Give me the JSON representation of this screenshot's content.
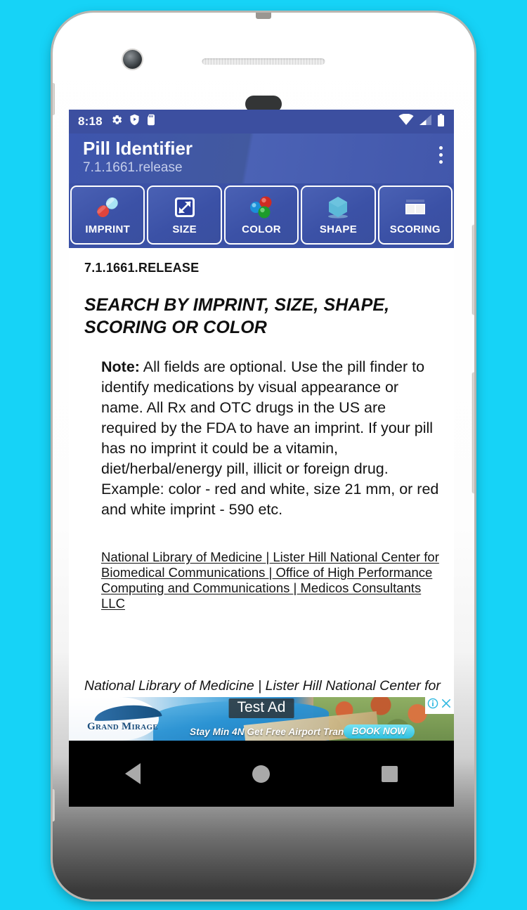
{
  "theme": {
    "background": "#16d3f7",
    "status_bar_bg": "#3c4fa0",
    "app_bar_bg": "#3e55ae",
    "tab_bar_bg": "#3b51a6",
    "accent_white": "#ffffff",
    "nav_bar_bg": "#000000",
    "nav_icon_color": "#a9a9a9"
  },
  "status_bar": {
    "time": "8:18",
    "left_icons": [
      "gear-icon",
      "shield-play-icon",
      "sd-card-icon"
    ],
    "right_icons": [
      "wifi-icon",
      "cellular-signal-icon",
      "battery-icon"
    ]
  },
  "app_bar": {
    "title": "Pill Identifier",
    "subtitle": "7.1.1661.release",
    "overflow_icon": "overflow-menu-icon"
  },
  "tabs": [
    {
      "label": "IMPRINT",
      "icon": "capsule-icon"
    },
    {
      "label": "SIZE",
      "icon": "size-arrow-icon"
    },
    {
      "label": "COLOR",
      "icon": "color-spheres-icon"
    },
    {
      "label": "SHAPE",
      "icon": "hexagon-icon"
    },
    {
      "label": "SCORING",
      "icon": "scoring-tablet-icon"
    }
  ],
  "content": {
    "release_label": "7.1.1661.RELEASE",
    "heading": "SEARCH BY IMPRINT, SIZE, SHAPE, SCORING OR COLOR",
    "note_label": "Note:",
    "note_body": " All fields are optional. Use the pill finder to identify medications by visual appearance or name. All Rx and OTC drugs in the US are required by the FDA to have an imprint. If your pill has no imprint it could be a vitamin, diet/herbal/energy pill, illicit or foreign drug. Example: color - red and white, size 21 mm, or red and white imprint - 590 etc.",
    "links_text": "National Library of Medicine | Lister Hill National Center for Biomedical Communications | Office of High Performance Computing and Communications | Medicos Consultants LLC",
    "footer_text": "National Library of Medicine | Lister Hill National Center for"
  },
  "ad": {
    "test_label": "Test Ad",
    "brand": "Grand Mirage",
    "tagline": "Stay Min 4N Get Free Airport Transfer",
    "cta_label": "BOOK NOW",
    "info_icon": "ad-info-icon",
    "close_icon": "ad-close-icon"
  },
  "nav_bar": {
    "back": "back-button",
    "home": "home-button",
    "recents": "recents-button"
  }
}
